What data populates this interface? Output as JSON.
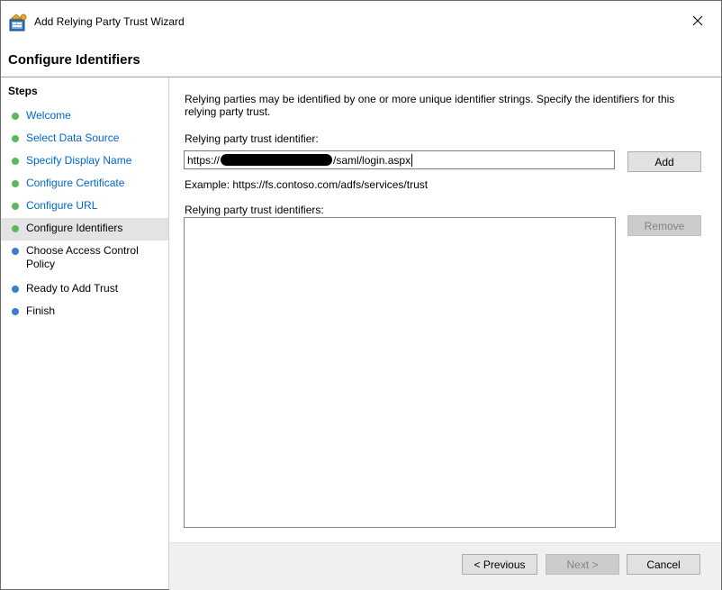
{
  "window": {
    "title": "Add Relying Party Trust Wizard",
    "app_icon": "relying-party-trust-icon",
    "close_icon": "close-icon"
  },
  "header": {
    "title": "Configure Identifiers"
  },
  "sidebar": {
    "heading": "Steps",
    "items": [
      {
        "label": "Welcome",
        "status": "done"
      },
      {
        "label": "Select Data Source",
        "status": "done"
      },
      {
        "label": "Specify Display Name",
        "status": "done"
      },
      {
        "label": "Configure Certificate",
        "status": "done"
      },
      {
        "label": "Configure URL",
        "status": "done"
      },
      {
        "label": "Configure Identifiers",
        "status": "current"
      },
      {
        "label": "Choose Access Control Policy",
        "status": "pending"
      },
      {
        "label": "Ready to Add Trust",
        "status": "pending"
      },
      {
        "label": "Finish",
        "status": "pending"
      }
    ]
  },
  "main": {
    "description": "Relying parties may be identified by one or more unique identifier strings. Specify the identifiers for this relying party trust.",
    "identifier_label": "Relying party trust identifier:",
    "identifier_value_prefix": "https://",
    "identifier_value_suffix": "/saml/login.aspx",
    "add_label": "Add",
    "example": "Example: https://fs.contoso.com/adfs/services/trust",
    "identifiers_list_label": "Relying party trust identifiers:",
    "identifiers_list": [],
    "remove_label": "Remove"
  },
  "footer": {
    "previous_label": "< Previous",
    "next_label": "Next >",
    "cancel_label": "Cancel"
  },
  "colors": {
    "step_done_dot": "#5cb85c",
    "step_pending_dot": "#3b7bd4",
    "step_done_text": "#0066cc",
    "current_step_bg": "#e3e3e3",
    "footer_bg": "#f0f0f0"
  }
}
